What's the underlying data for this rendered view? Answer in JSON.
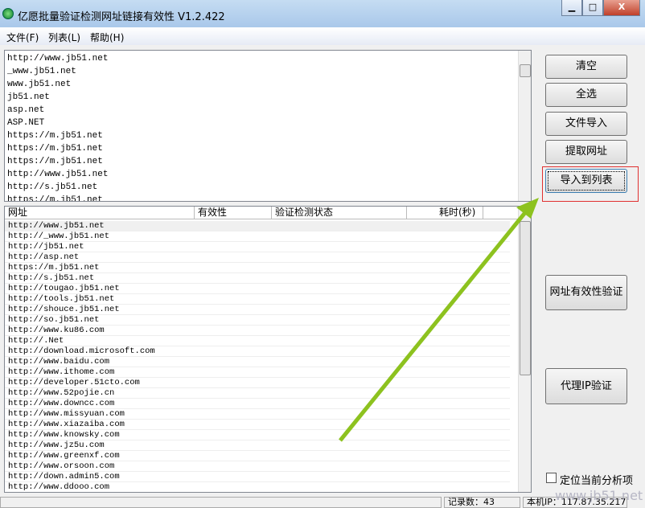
{
  "window": {
    "title": "亿愿批量验证检测网址链接有效性 V1.2.422",
    "minimize": "▁",
    "maximize": "□",
    "close": "X"
  },
  "menu": [
    "文件(F)",
    "列表(L)",
    "帮助(H)"
  ],
  "input_lines": [
    "http://www.jb51.net",
    "_www.jb51.net",
    "www.jb51.net",
    "jb51.net",
    "asp.net",
    "ASP.NET",
    "https://m.jb51.net",
    "https://m.jb51.net",
    "https://m.jb51.net",
    "http://www.jb51.net",
    "http://s.jb51.net",
    "https://m.jb51.net"
  ],
  "table": {
    "columns": [
      "网址",
      "有效性",
      "验证检测状态",
      "耗时(秒)"
    ],
    "rows": [
      "http://www.jb51.net",
      "http://_www.jb51.net",
      "http://jb51.net",
      "http://asp.net",
      "https://m.jb51.net",
      "http://s.jb51.net",
      "http://tougao.jb51.net",
      "http://tools.jb51.net",
      "http://shouce.jb51.net",
      "http://so.jb51.net",
      "http://www.ku86.com",
      "http://.Net",
      "http://download.microsoft.com",
      "http://www.baidu.com",
      "http://www.ithome.com",
      "http://developer.51cto.com",
      "http://www.52pojie.cn",
      "http://www.downcc.com",
      "http://www.missyuan.com",
      "http://www.xiazaiba.com",
      "http://www.knowsky.com",
      "http://www.jz5u.com",
      "http://www.greenxf.com",
      "http://www.orsoon.com",
      "http://down.admin5.com",
      "http://www.ddooo.com"
    ]
  },
  "buttons": {
    "clear": "清空",
    "select_all": "全选",
    "file_import": "文件导入",
    "extract_url": "提取网址",
    "import_to_list": "导入到列表",
    "validate_url": "网址有效性验证",
    "proxy_validate": "代理IP验证"
  },
  "checkbox": {
    "label": "定位当前分析项",
    "checked": false
  },
  "status": {
    "records": "记录数：43",
    "ip": "本机IP：117.87.35.217"
  },
  "watermark": "www.jb51.net",
  "colors": {
    "highlight_box": "#e03030",
    "arrow": "#8dc21f"
  }
}
